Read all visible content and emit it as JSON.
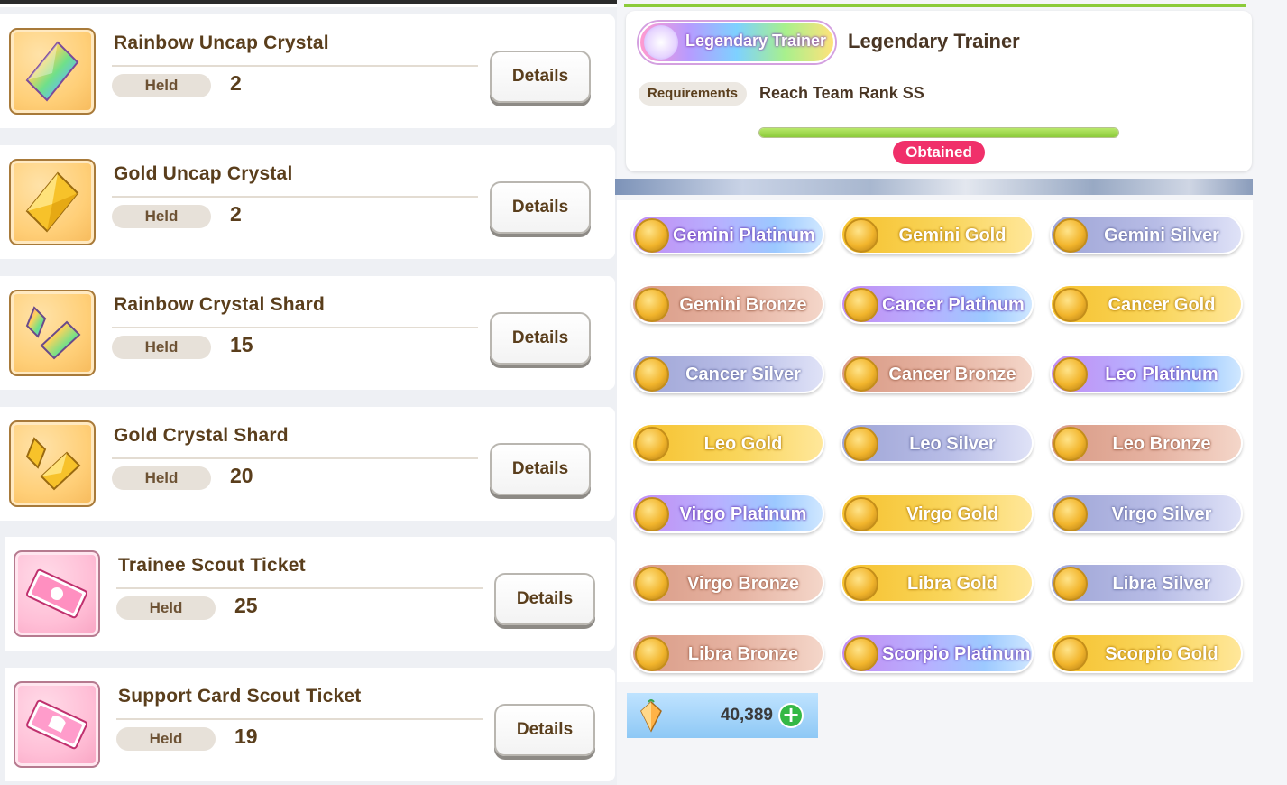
{
  "items": [
    {
      "name": "Rainbow Uncap Crystal",
      "held_label": "Held",
      "held_count": "2",
      "details_label": "Details",
      "icon": "rainbow-crystal-icon"
    },
    {
      "name": "Gold Uncap Crystal",
      "held_label": "Held",
      "held_count": "2",
      "details_label": "Details",
      "icon": "gold-crystal-icon"
    },
    {
      "name": "Rainbow Crystal Shard",
      "held_label": "Held",
      "held_count": "15",
      "details_label": "Details",
      "icon": "rainbow-shard-icon"
    },
    {
      "name": "Gold Crystal Shard",
      "held_label": "Held",
      "held_count": "20",
      "details_label": "Details",
      "icon": "gold-shard-icon"
    },
    {
      "name": "Trainee Scout Ticket",
      "held_label": "Held",
      "held_count": "25",
      "details_label": "Details",
      "icon": "trainee-ticket-icon"
    },
    {
      "name": "Support Card Scout Ticket",
      "held_label": "Held",
      "held_count": "19",
      "details_label": "Details",
      "icon": "support-ticket-icon"
    }
  ],
  "title_detail": {
    "badge_text": "Legendary Trainer",
    "name": "Legendary Trainer",
    "requirements_label": "Requirements",
    "requirement": "Reach Team Rank SS",
    "progress": 1.0,
    "status": "Obtained"
  },
  "titles": [
    {
      "label": "Gemini Platinum",
      "tier": "platinum"
    },
    {
      "label": "Gemini Gold",
      "tier": "gold"
    },
    {
      "label": "Gemini Silver",
      "tier": "silver"
    },
    {
      "label": "Gemini Bronze",
      "tier": "bronze"
    },
    {
      "label": "Cancer Platinum",
      "tier": "platinum"
    },
    {
      "label": "Cancer Gold",
      "tier": "gold"
    },
    {
      "label": "Cancer Silver",
      "tier": "silver"
    },
    {
      "label": "Cancer Bronze",
      "tier": "bronze"
    },
    {
      "label": "Leo Platinum",
      "tier": "platinum"
    },
    {
      "label": "Leo Gold",
      "tier": "gold"
    },
    {
      "label": "Leo Silver",
      "tier": "silver"
    },
    {
      "label": "Leo Bronze",
      "tier": "bronze"
    },
    {
      "label": "Virgo Platinum",
      "tier": "platinum"
    },
    {
      "label": "Virgo Gold",
      "tier": "gold"
    },
    {
      "label": "Virgo Silver",
      "tier": "silver"
    },
    {
      "label": "Virgo Bronze",
      "tier": "bronze"
    },
    {
      "label": "Libra Gold",
      "tier": "gold"
    },
    {
      "label": "Libra Silver",
      "tier": "silver"
    },
    {
      "label": "Libra Bronze",
      "tier": "bronze"
    },
    {
      "label": "Scorpio Platinum",
      "tier": "platinum"
    },
    {
      "label": "Scorpio Gold",
      "tier": "gold"
    }
  ],
  "currency": {
    "value": "40,389",
    "icon": "carrot-jewel-icon",
    "add_icon": "plus-icon"
  },
  "colors": {
    "accent_green": "#8ccb3a",
    "obtained_pink": "#f0306a",
    "text_brown": "#5a3e1c"
  }
}
